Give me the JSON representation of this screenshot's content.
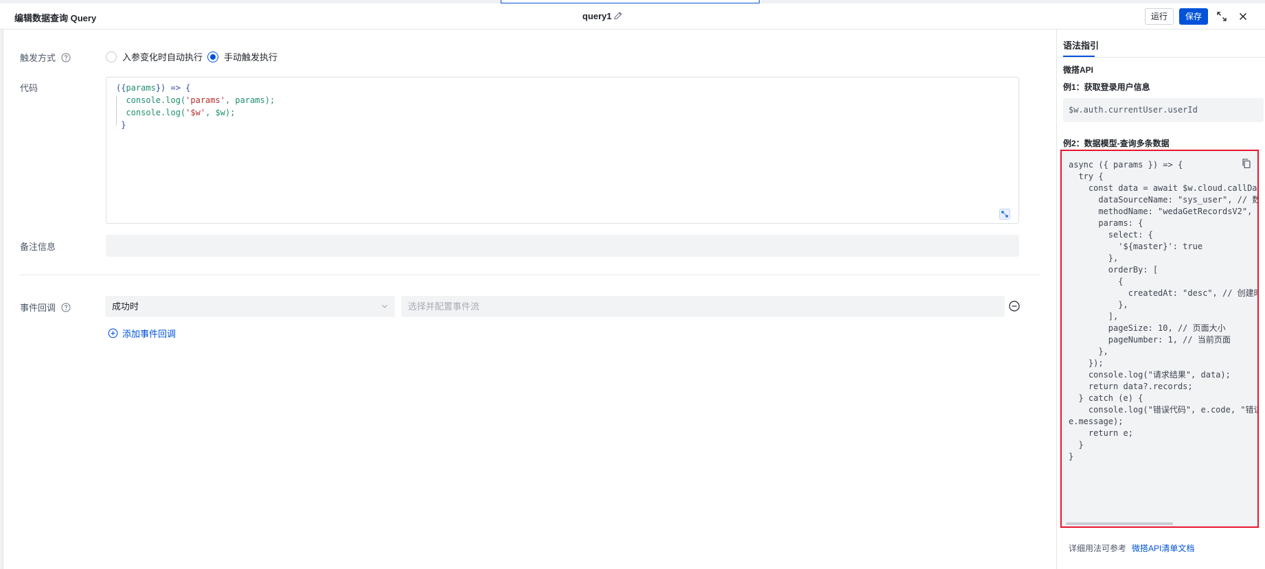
{
  "header": {
    "title": "编辑数据查询 Query",
    "query_name": "query1",
    "run_label": "运行",
    "save_label": "保存"
  },
  "trigger": {
    "label": "触发方式",
    "options": [
      {
        "label": "入参变化时自动执行",
        "selected": false
      },
      {
        "label": "手动触发执行",
        "selected": true
      }
    ]
  },
  "code": {
    "label": "代码",
    "lines": [
      "({params}) => {",
      "  console.log('params', params);",
      "  console.log('$w', $w);",
      "}"
    ]
  },
  "note": {
    "label": "备注信息",
    "value": ""
  },
  "callback": {
    "label": "事件回调",
    "select_value": "成功时",
    "flow_placeholder": "选择并配置事件流",
    "add_label": "添加事件回调"
  },
  "guide": {
    "tab": "语法指引",
    "section": "微搭API",
    "ex1_title": "例1：获取登录用户信息",
    "ex1_code": "$w.auth.currentUser.userId",
    "ex2_title": "例2：数据模型-查询多条数据",
    "ex2_lines": [
      "async ({ params }) => {",
      "  try {",
      "    const data = await $w.cloud.callDa",
      "      dataSourceName: \"sys_user\", // 数",
      "      methodName: \"wedaGetRecordsV2\",",
      "      params: {",
      "        select: {",
      "          '${master}': true",
      "        },",
      "        orderBy: [",
      "          {",
      "            createdAt: \"desc\", // 创建时",
      "          },",
      "        ],",
      "        pageSize: 10, // 页面大小",
      "        pageNumber: 1, // 当前页面",
      "      },",
      "    });",
      "    console.log(\"请求结果\", data);",
      "    return data?.records;",
      "  } catch (e) {",
      "    console.log(\"错误代码\", e.code, \"错误",
      "e.message);",
      "    return e;",
      "  }",
      "}"
    ],
    "footer_text": "详细用法可参考",
    "footer_link": "微搭API清单文档"
  },
  "colors": {
    "primary": "#0052d9",
    "highlight_border": "#e8142e"
  }
}
